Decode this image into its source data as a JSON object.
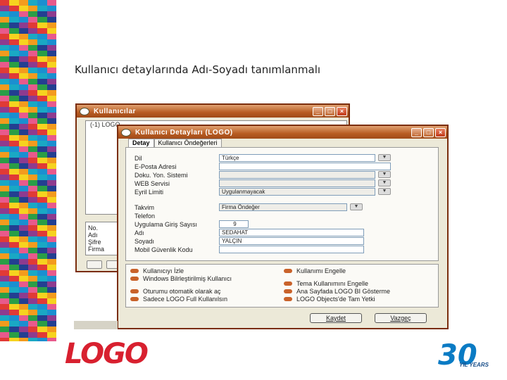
{
  "slide": {
    "title": "Kullanıcı detaylarında Adı-Soyadı tanımlanmalı"
  },
  "stripe_colors": [
    "#e13a36",
    "#f39b1e",
    "#1b8fd0",
    "#2a9e47",
    "#8e3b8f",
    "#f6d31f",
    "#1aa8c4",
    "#e85a8c",
    "#233f91"
  ],
  "users_window": {
    "title": "Kullanıcılar",
    "tree": [
      "(-1) LOGO",
      "",
      "",
      "",
      "",
      ""
    ],
    "info": [
      "No.",
      "Adı",
      "Şifre",
      "Firma"
    ]
  },
  "details_window": {
    "title": "Kullanıcı Detayları (LOGO)",
    "tabs": [
      "Detay",
      "Kullanıcı Öndeğerleri"
    ],
    "fields": {
      "dil_label": "Dil",
      "dil_value": "Türkçe",
      "eposta_label": "E-Posta Adresi",
      "doku_label": "Doku. Yon. Sistemi",
      "web_label": "WEB Servisi",
      "eyril_label": "Eyril Limiti",
      "eyril_value": "Uygulanmayacak",
      "takvim_label": "Takvim",
      "takvim_value": "Firma Öndeğer",
      "telefon_label": "Telefon",
      "giris_label": "Uygulama Giriş Sayısı",
      "giris_value": "9",
      "adi_label": "Adı",
      "adi_value": "SEDAHAT",
      "soyadi_label": "Soyadı",
      "soyadi_value": "YALÇIN",
      "mobil_label": "Mobil Güvenlik Kodu"
    },
    "options": [
      "Kullanıcıyı İzle",
      "Windows Bilrleştirilmiş Kullanıcı",
      "Oturumu otomatik olarak aç",
      "Sadece LOGO Full Kullanılsın",
      "Kullanımı Engelle",
      "Tema Kullanımını Engelle",
      "Ana Sayfada LOGO BI Gösterme",
      "LOGO Objects'de Tam Yetki"
    ],
    "buttons": {
      "save": "Kaydet",
      "cancel": "Vazgeç"
    }
  },
  "logo_text": "LOGO",
  "badge": {
    "number": "30",
    "subtitle": "YIL YEARS"
  }
}
